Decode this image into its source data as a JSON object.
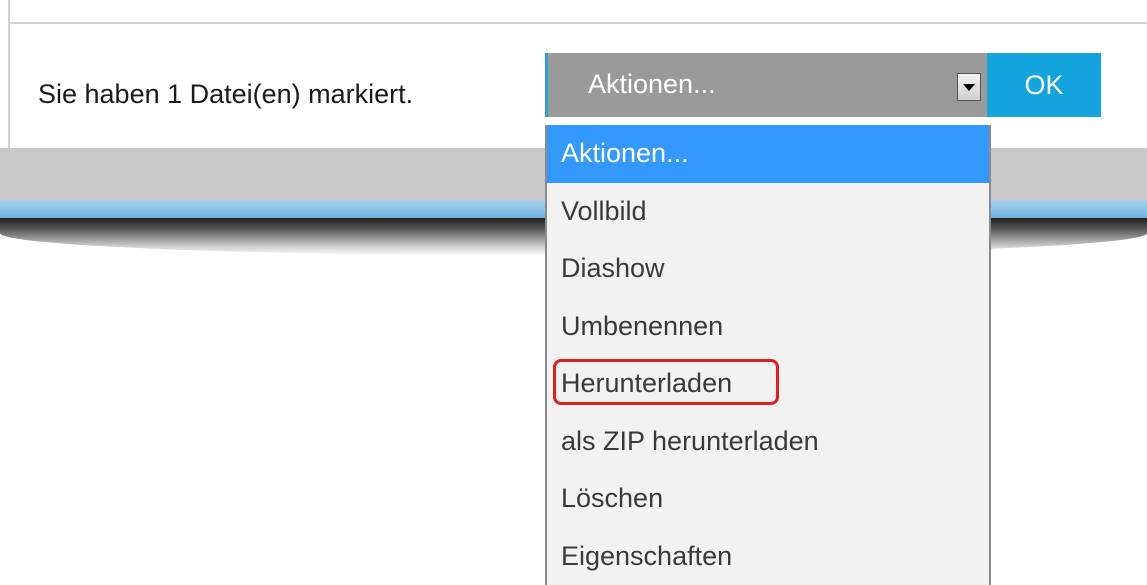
{
  "status": {
    "selection_text": "Sie haben 1 Datei(en) markiert."
  },
  "actions_select": {
    "current_value": "Aktionen...",
    "ok_label": "OK",
    "options": [
      "Aktionen...",
      "Vollbild",
      "Diashow",
      "Umbenennen",
      "Herunterladen",
      "als ZIP herunterladen",
      "Löschen",
      "Eigenschaften"
    ],
    "highlighted_option_index": 0,
    "annotated_option_index": 4
  },
  "colors": {
    "select_bg": "#9a9a9a",
    "ok_button": "#13a3dd",
    "option_selected": "#3399ff",
    "annotation_ring": "#e02020"
  }
}
